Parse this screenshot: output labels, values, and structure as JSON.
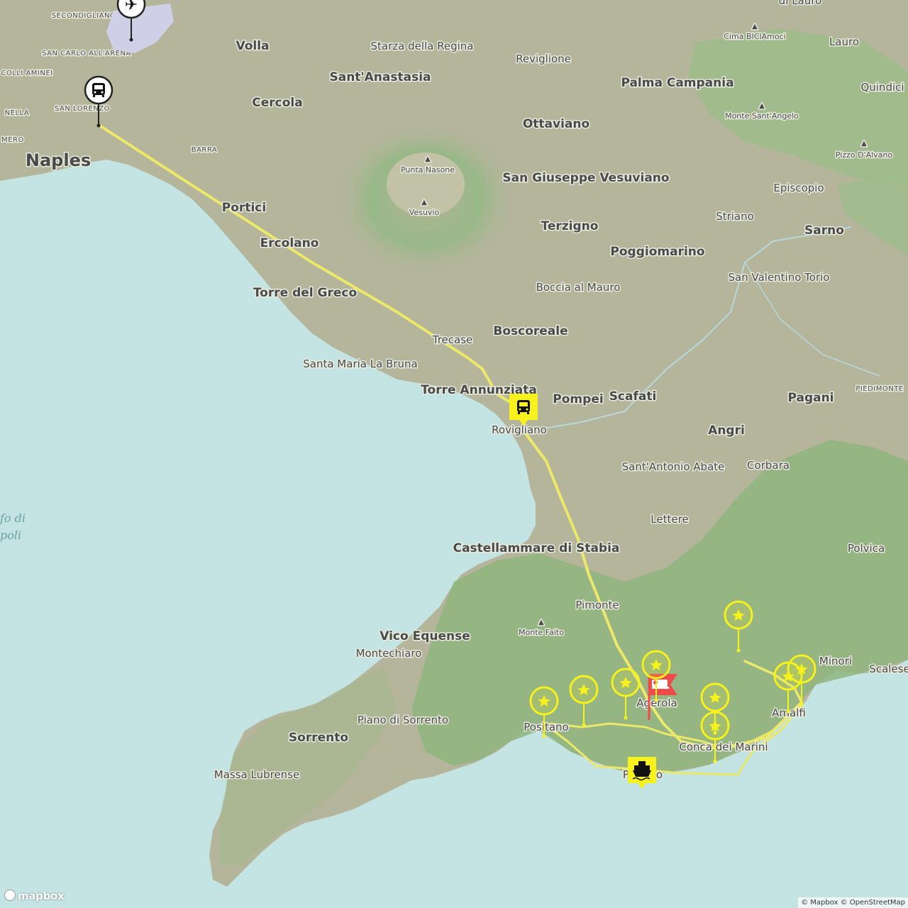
{
  "map": {
    "colors": {
      "sea": "#c3e4e2",
      "land": "#b4b59b",
      "forest": "#8ab57c",
      "route": "#ece86a",
      "marker": "#f7f21b",
      "hotel": "#ee4c4c"
    },
    "water_labels": [
      "fo di",
      "poli"
    ],
    "towns_large": [
      "Naples",
      "Volla",
      "Sant'Anastasia",
      "Cercola",
      "Ottaviano",
      "Palma Campania",
      "Portici",
      "Ercolano",
      "Torre del Greco",
      "San Giuseppe Vesuviano",
      "Terzigno",
      "Poggiomarino",
      "Sarno",
      "Boscoreale",
      "Torre Annunziata",
      "Pompei",
      "Scafati",
      "Angri",
      "Pagani",
      "Castellammare di Stabia",
      "Vico Equense",
      "Sorrento"
    ],
    "towns_small": [
      "Starza della Regina",
      "Reviglione",
      "Lauro",
      "Quindici",
      "Episcopio",
      "Striano",
      "San Valentino Torio",
      "Boccia al Mauro",
      "Trecase",
      "Santa Maria La Bruna",
      "Rovigliano",
      "Sant'Antonio Abate",
      "Corbara",
      "Lettere",
      "Polvica",
      "Pimonte",
      "Montechiaro",
      "Piano di Sorrento",
      "Massa Lubrense",
      "Positano",
      "Agerola",
      "Amalfi",
      "Minori",
      "Scalese",
      "Praiano",
      "Conca dei Marini",
      "di Lauro"
    ],
    "districts": [
      "SECONDIGLIANO",
      "SAN CARLO ALL'ARENA",
      "COLLI AMINEI",
      "SAN LORENZO",
      "BARRA",
      "NELLA",
      "MERO",
      "PIEDIMONTE"
    ],
    "peaks": [
      "Punta Nasone",
      "Vesuvio",
      "Cima BICIAmoci",
      "Monte Sant'Angelo",
      "Pizzo D'Alvano",
      "Monte Faito"
    ],
    "markers": [
      {
        "name": "airport",
        "icon": "airplane-icon"
      },
      {
        "name": "bus-naples",
        "icon": "bus-icon"
      },
      {
        "name": "bus-rovigliano",
        "icon": "bus-icon"
      },
      {
        "name": "ferry",
        "icon": "ferry-icon"
      },
      {
        "name": "hotel",
        "icon": "bed-icon"
      },
      {
        "name": "poi",
        "icon": "star-icon",
        "count": 9
      }
    ]
  },
  "attribution": {
    "logo": "mapbox",
    "text": "© Mapbox © OpenStreetMap"
  }
}
